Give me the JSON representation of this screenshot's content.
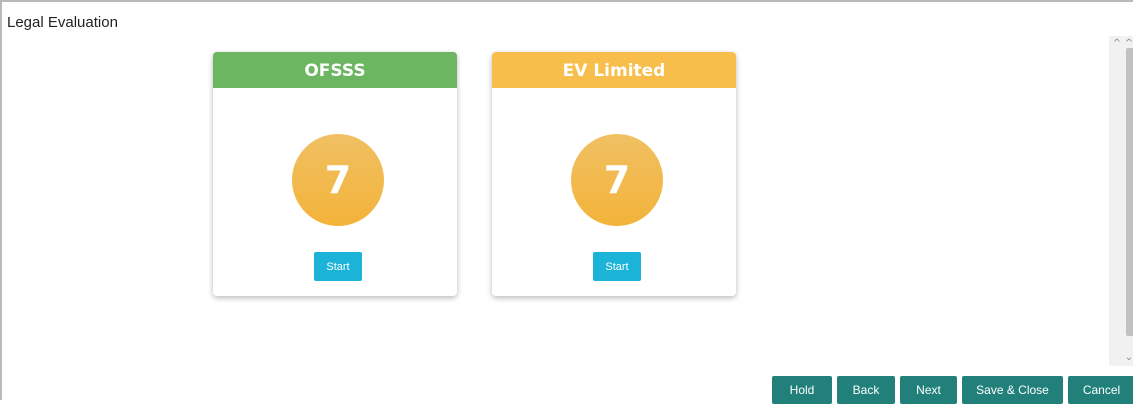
{
  "page": {
    "title": "Legal Evaluation"
  },
  "cards": [
    {
      "name": "OFSSS",
      "count": "7",
      "header_color": "#6cb561",
      "start_label": "Start"
    },
    {
      "name": "EV Limited",
      "count": "7",
      "header_color": "#f8be4c",
      "start_label": "Start"
    }
  ],
  "actions": {
    "hold": "Hold",
    "back": "Back",
    "next": "Next",
    "save_close": "Save & Close",
    "cancel": "Cancel"
  },
  "colors": {
    "action_button": "#21807a",
    "start_button": "#1bb4d8",
    "count_circle": "#f3b33a"
  },
  "icons": {
    "scroll_up": "chevron-up-icon",
    "scroll_down": "chevron-down-icon"
  }
}
